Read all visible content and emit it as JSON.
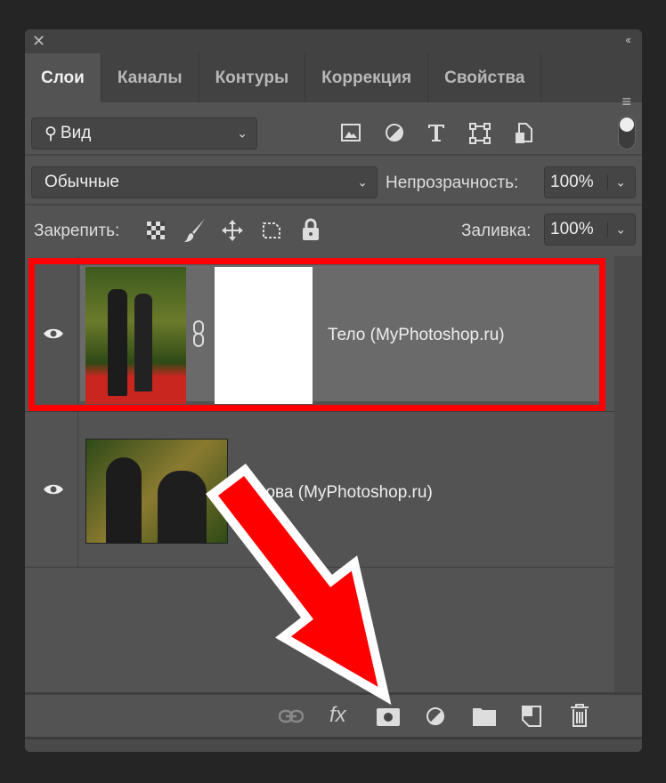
{
  "panel": {
    "close": "✕",
    "collapse": "‹‹",
    "menu": "≡"
  },
  "tabs": [
    {
      "label": "Слои"
    },
    {
      "label": "Каналы"
    },
    {
      "label": "Контуры"
    },
    {
      "label": "Коррекция"
    },
    {
      "label": "Свойства"
    }
  ],
  "filter": {
    "label": "Вид"
  },
  "blend": {
    "mode": "Обычные",
    "opacity_label": "Непрозрачность:",
    "opacity": "100%"
  },
  "lock": {
    "label": "Закрепить:",
    "fill_label": "Заливка:",
    "fill": "100%"
  },
  "layers": [
    {
      "name": "Тело (MyPhotoshop.ru)",
      "selected": true,
      "has_mask": true
    },
    {
      "name": "Голова (MyPhotoshop.ru)",
      "selected": false
    }
  ],
  "colors": {
    "highlight": "#ff0000",
    "panel": "#535353"
  }
}
